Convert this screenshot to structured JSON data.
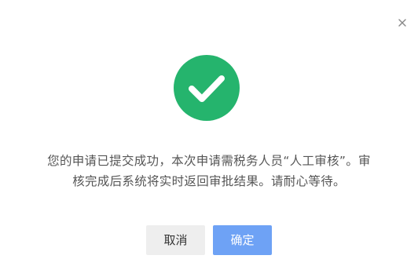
{
  "dialog": {
    "close_symbol": "×",
    "icon": "success-check-icon",
    "icon_color": "#25b46d",
    "message_line1": "您的申请已提交成功，本次申请需税务人员“人工审核”。审",
    "message_line2": "核完成后系统将实时返回审批结果。请耐心等待。",
    "cancel_label": "取消",
    "ok_label": "确定"
  }
}
